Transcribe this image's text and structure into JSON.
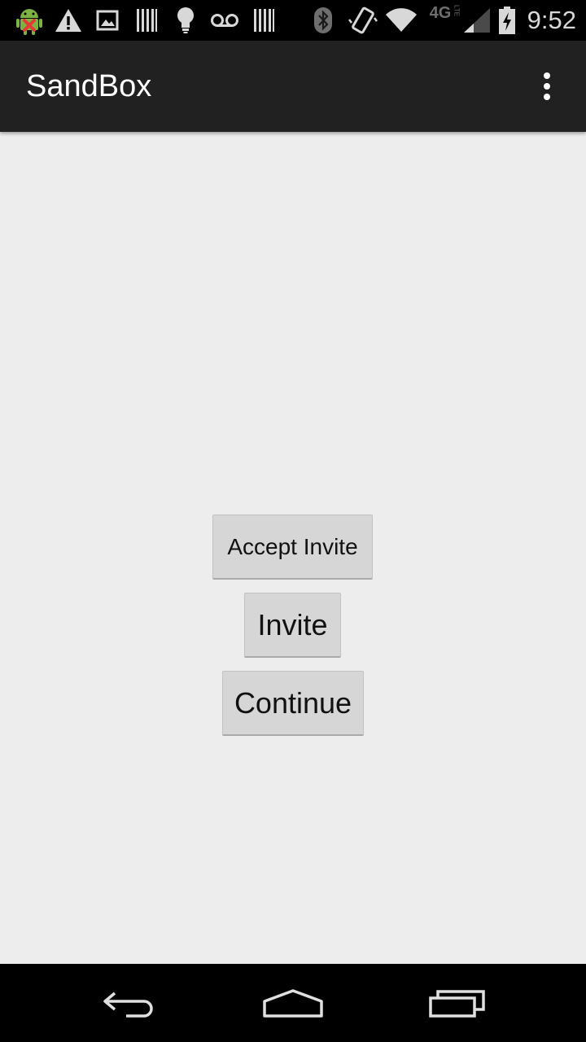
{
  "status_bar": {
    "time": "9:52",
    "network_label": "4G",
    "network_sub_label": "LTE",
    "icons": [
      "android-debug-icon",
      "warning-icon",
      "image-icon",
      "barcode-icon",
      "lightbulb-icon",
      "voicemail-icon",
      "barcode-icon",
      "bluetooth-icon",
      "vibrate-icon",
      "wifi-icon",
      "4g-lte-icon",
      "cell-signal-icon",
      "battery-charging-icon"
    ]
  },
  "action_bar": {
    "title": "SandBox",
    "overflow_icon": "more-vert-icon"
  },
  "main": {
    "buttons": {
      "accept_invite": "Accept Invite",
      "invite": "Invite",
      "continue": "Continue"
    }
  },
  "nav_bar": {
    "icons": [
      "back-icon",
      "home-icon",
      "recents-icon"
    ]
  },
  "colors": {
    "action_bar_bg": "#212121",
    "content_bg": "#ededed",
    "button_bg": "#d6d6d6",
    "status_icon": "#d8d8d8"
  }
}
